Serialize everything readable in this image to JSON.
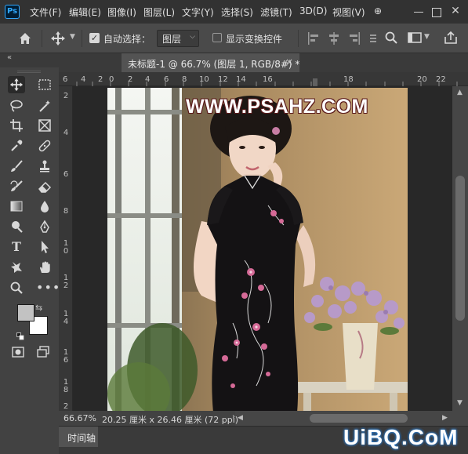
{
  "menubar": {
    "logo": "Ps",
    "items": [
      "文件(F)",
      "编辑(E)",
      "图像(I)",
      "图层(L)",
      "文字(Y)",
      "选择(S)",
      "滤镜(T)",
      "3D(D)",
      "视图(V)"
    ],
    "overflow": "⊕"
  },
  "options": {
    "auto_select_label": "自动选择：",
    "auto_select_checked": true,
    "layer_target": "图层",
    "show_transform_label": "显示变换控件",
    "show_transform_checked": false
  },
  "tab": {
    "title": "未标题-1 @ 66.7% (图层 1, RGB/8#) *",
    "close": "×"
  },
  "panel_collapse": "«",
  "ruler_top": [
    "6",
    "4",
    "2",
    "0",
    "2",
    "4",
    "6",
    "8",
    "10",
    "12",
    "14",
    "16",
    "18",
    "20",
    "22"
  ],
  "ruler_left": [
    "2",
    "4",
    "6",
    "8",
    "1 0",
    "1 2",
    "1 4",
    "1 6",
    "1 8",
    "2 0"
  ],
  "document": {
    "watermark": "WWW.PSAHZ.COM"
  },
  "status": {
    "zoom": "66.67%",
    "doc_info": "20.25 厘米 x 26.46 厘米 (72 ppi)",
    "caret": "›"
  },
  "bottom_panel": {
    "tab": "时间轴"
  },
  "brand_watermark": "UiBQ.CoM",
  "colors": {
    "foreground": "#c2c2c2",
    "background": "#ffffff",
    "ps_accent": "#31a8ff"
  }
}
